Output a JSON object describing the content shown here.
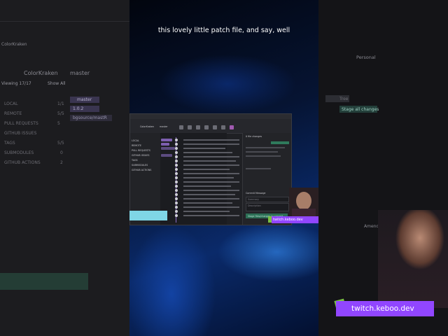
{
  "caption": "this lovely little patch file, and say, well",
  "left_app": {
    "repo_label": "ColorKraken",
    "branch_label": "master",
    "viewing": "Viewing 17/17",
    "show_all": "Show All",
    "sections": [
      {
        "label": "LOCAL",
        "count": "1/1"
      },
      {
        "label": "REMOTE",
        "count": "5/5"
      },
      {
        "label": "PULL REQUESTS",
        "count": "5"
      },
      {
        "label": "GITHUB ISSUES",
        "count": ""
      },
      {
        "label": "TAGS",
        "count": "5/5"
      },
      {
        "label": "SUBMODULES",
        "count": "0"
      },
      {
        "label": "GITHUB ACTIONS",
        "count": "2"
      }
    ],
    "branch_tags": [
      "master",
      "1.0.2",
      "bgsource/mastR"
    ]
  },
  "right_app": {
    "profile": "Personal",
    "stage_all": "Stage all changes",
    "amend": "Amend",
    "tree": "Tree"
  },
  "gitkraken": {
    "repo": "ColorKraken",
    "branch": "master",
    "sidebar_items": [
      "LOCAL",
      "REMOTE",
      "PULL REQUESTS",
      "GITHUB ISSUES",
      "TAGS",
      "SUBMODULES",
      "GITHUB ACTIONS"
    ],
    "commit_message_label": "Commit Message",
    "summary_placeholder": "Summary",
    "description_placeholder": "Description",
    "stage_button": "Stage files/changes to commit",
    "file_changes_label": "0 file changes"
  },
  "twitch_small": "twitch.keboo.dev",
  "twitch_big": "twitch.keboo.dev"
}
